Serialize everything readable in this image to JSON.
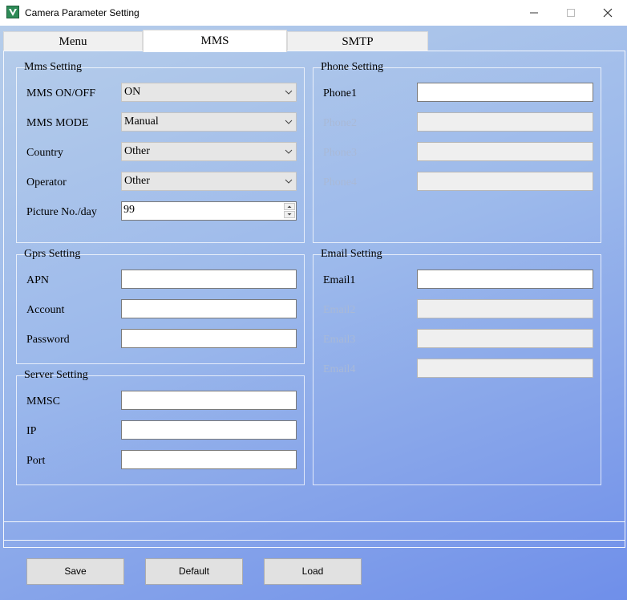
{
  "window": {
    "title": "Camera Parameter Setting",
    "icon": "app-logo-icon",
    "controls": [
      "minimize-icon",
      "maximize-icon",
      "close-icon"
    ]
  },
  "tabs": [
    {
      "label": "Menu",
      "active": false
    },
    {
      "label": "MMS",
      "active": true
    },
    {
      "label": "SMTP",
      "active": false
    }
  ],
  "mms_setting": {
    "title": "Mms Setting",
    "mms_onoff": {
      "label": "MMS ON/OFF",
      "value": "ON"
    },
    "mms_mode": {
      "label": "MMS MODE",
      "value": "Manual"
    },
    "country": {
      "label": "Country",
      "value": "Other"
    },
    "operator": {
      "label": "Operator",
      "value": "Other"
    },
    "picture_per_day": {
      "label": "Picture No./day",
      "value": "99"
    }
  },
  "phone_setting": {
    "title": "Phone Setting",
    "phone1": {
      "label": "Phone1",
      "value": ""
    },
    "phone2": {
      "label": "Phone2",
      "value": ""
    },
    "phone3": {
      "label": "Phone3",
      "value": ""
    },
    "phone4": {
      "label": "Phone4",
      "value": ""
    }
  },
  "gprs_setting": {
    "title": "Gprs Setting",
    "apn": {
      "label": "APN",
      "value": ""
    },
    "account": {
      "label": "Account",
      "value": ""
    },
    "password": {
      "label": "Password",
      "value": ""
    }
  },
  "email_setting": {
    "title": "Email Setting",
    "email1": {
      "label": "Email1",
      "value": ""
    },
    "email2": {
      "label": "Email2",
      "value": ""
    },
    "email3": {
      "label": "Email3",
      "value": ""
    },
    "email4": {
      "label": "Email4",
      "value": ""
    }
  },
  "server_setting": {
    "title": "Server Setting",
    "mmsc": {
      "label": "MMSC",
      "value": ""
    },
    "ip": {
      "label": "IP",
      "value": ""
    },
    "port": {
      "label": "Port",
      "value": ""
    }
  },
  "buttons": {
    "save": "Save",
    "default": "Default",
    "load": "Load"
  }
}
